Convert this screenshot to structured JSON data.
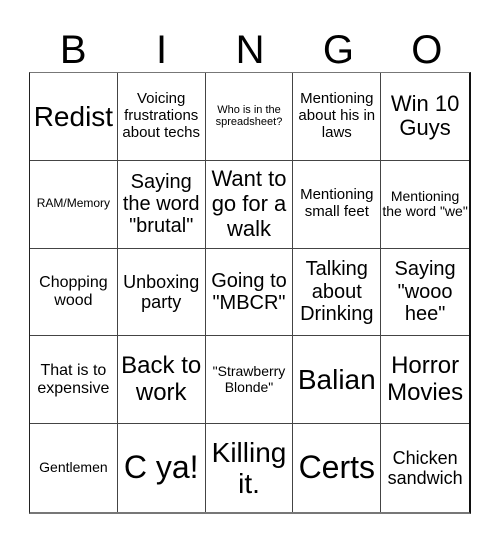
{
  "title_letters": [
    "B",
    "I",
    "N",
    "G",
    "O"
  ],
  "cells": [
    "Redist",
    "Voicing frustrations about techs",
    "Who is in the spreadsheet?",
    "Mentioning about his in laws",
    "Win 10 Guys",
    "RAM/Memory",
    "Saying the word \"brutal\"",
    "Want to go for a walk",
    "Mentioning small feet",
    "Mentioning the word \"we\"",
    "Chopping wood",
    "Unboxing party",
    "Going to \"MBCR\"",
    "Talking about Drinking",
    "Saying \"wooo hee\"",
    "That is to expensive",
    "Back to work",
    "\"Strawberry Blonde\"",
    "Balian",
    "Horror Movies",
    "Gentlemen",
    "C ya!",
    "Killing it.",
    "Certs",
    "Chicken sandwich"
  ]
}
